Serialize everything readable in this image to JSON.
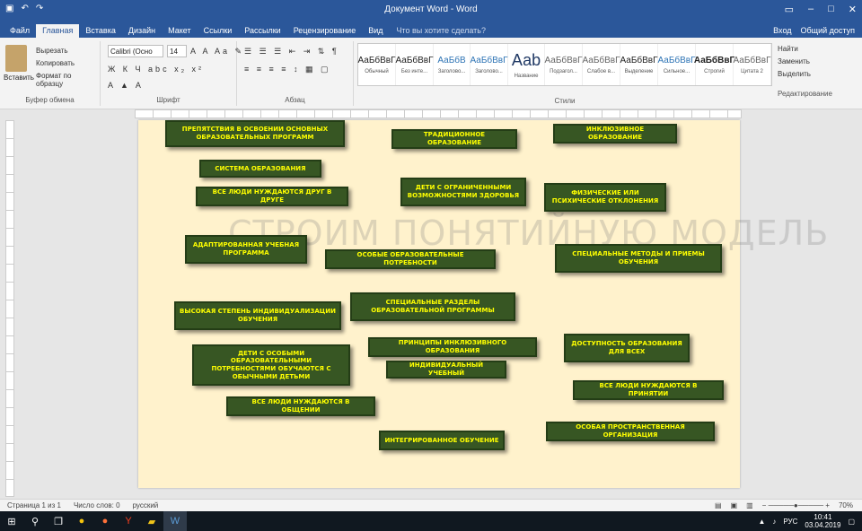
{
  "window": {
    "title": "Документ Word - Word",
    "qat_icons": [
      "save-icon",
      "undo-icon",
      "redo-icon"
    ]
  },
  "ribbon_tabs": [
    "Файл",
    "Главная",
    "Вставка",
    "Дизайн",
    "Макет",
    "Ссылки",
    "Рассылки",
    "Рецензирование",
    "Вид"
  ],
  "tell_me": "Что вы хотите сделать?",
  "account": [
    "Вход",
    "Общий доступ"
  ],
  "ribbon": {
    "paste": "Вставить",
    "clip_items": [
      "Вырезать",
      "Копировать",
      "Формат по образцу"
    ],
    "font_name": "Calibri (Осно",
    "font_size": "14",
    "styles": [
      {
        "sample": "АаБбВвГ",
        "name": "Обычный"
      },
      {
        "sample": "АаБбВвГ",
        "name": "Без инте..."
      },
      {
        "sample": "АаБбВ",
        "name": "Заголово..."
      },
      {
        "sample": "АаБбВвГ",
        "name": "Заголово..."
      },
      {
        "sample": "Ааb",
        "name": "Название"
      },
      {
        "sample": "АаБбВвГ",
        "name": "Подзагол..."
      },
      {
        "sample": "АаБбВвГ",
        "name": "Слабое в..."
      },
      {
        "sample": "АаБбВвГ",
        "name": "Выделение"
      },
      {
        "sample": "АаБбВвГ",
        "name": "Сильное..."
      },
      {
        "sample": "АаБбВвГ",
        "name": "Строгий"
      },
      {
        "sample": "АаБбВвГ",
        "name": "Цитата 2"
      }
    ],
    "edit_items": [
      "Найти",
      "Заменить",
      "Выделить"
    ],
    "group_labels": [
      "Буфер обмена",
      "Шрифт",
      "Абзац",
      "Стили",
      "Редактирование"
    ]
  },
  "watermark": "СТРОИМ ПОНЯТИЙНУЮ МОДЕЛЬ",
  "cards": [
    "ПРЕПЯТСТВИЯ В ОСВОЕНИИ ОСНОВНЫХ ОБРАЗОВАТЕЛЬНЫХ ПРОГРАММ",
    "ТРАДИЦИОННОЕ ОБРАЗОВАНИЕ",
    "ИНКЛЮЗИВНОЕ ОБРАЗОВАНИЕ",
    "СИСТЕМА ОБРАЗОВАНИЯ",
    "ВСЕ ЛЮДИ НУЖДАЮТСЯ ДРУГ В ДРУГЕ",
    "ДЕТИ С ОГРАНИЧЕННЫМИ ВОЗМОЖНОСТЯМИ ЗДОРОВЬЯ",
    "ФИЗИЧЕСКИЕ ИЛИ ПСИХИЧЕСКИЕ ОТКЛОНЕНИЯ",
    "АДАПТИРОВАННАЯ УЧЕБНАЯ ПРОГРАММА",
    "ОСОБЫЕ ОБРАЗОВАТЕЛЬНЫЕ ПОТРЕБНОСТИ",
    "СПЕЦИАЛЬНЫЕ МЕТОДЫ И ПРИЕМЫ ОБУЧЕНИЯ",
    "СПЕЦИАЛЬНЫЕ РАЗДЕЛЫ ОБРАЗОВАТЕЛЬНОЙ ПРОГРАММЫ",
    "ВЫСОКАЯ СТЕПЕНЬ ИНДИВИДУАЛИЗАЦИИ ОБУЧЕНИЯ",
    "ПРИНЦИПЫ ИНКЛЮЗИВНОГО ОБРАЗОВАНИЯ",
    "ДОСТУПНОСТЬ ОБРАЗОВАНИЯ ДЛЯ ВСЕХ",
    "ДЕТИ С ОСОБЫМИ ОБРАЗОВАТЕЛЬНЫМИ ПОТРЕБНОСТЯМИ ОБУЧАЮТСЯ С ОБЫЧНЫМИ ДЕТЬМИ",
    "ИНДИВИДУАЛЬНЫЙ УЧЕБНЫЙ",
    "ВСЕ ЛЮДИ НУЖДАЮТСЯ В ПРИНЯТИИ",
    "ВСЕ ЛЮДИ НУЖДАЮТСЯ В ОБЩЕНИИ",
    "ИНТЕГРИРОВАННОЕ ОБУЧЕНИЕ",
    "ОСОБАЯ ПРОСТРАНСТВЕННАЯ ОРГАНИЗАЦИЯ"
  ],
  "statusbar": {
    "page": "Страница 1 из 1",
    "words": "Число слов: 0",
    "lang": "русский",
    "zoom": "70%"
  },
  "taskbar": {
    "icons": [
      "windows-icon",
      "search-icon",
      "taskview-icon",
      "chrome-icon",
      "firefox-icon",
      "yandex-icon",
      "explorer-icon",
      "word-icon"
    ],
    "lang": "РУС",
    "time": "10:41",
    "date": "03.04.2019"
  }
}
